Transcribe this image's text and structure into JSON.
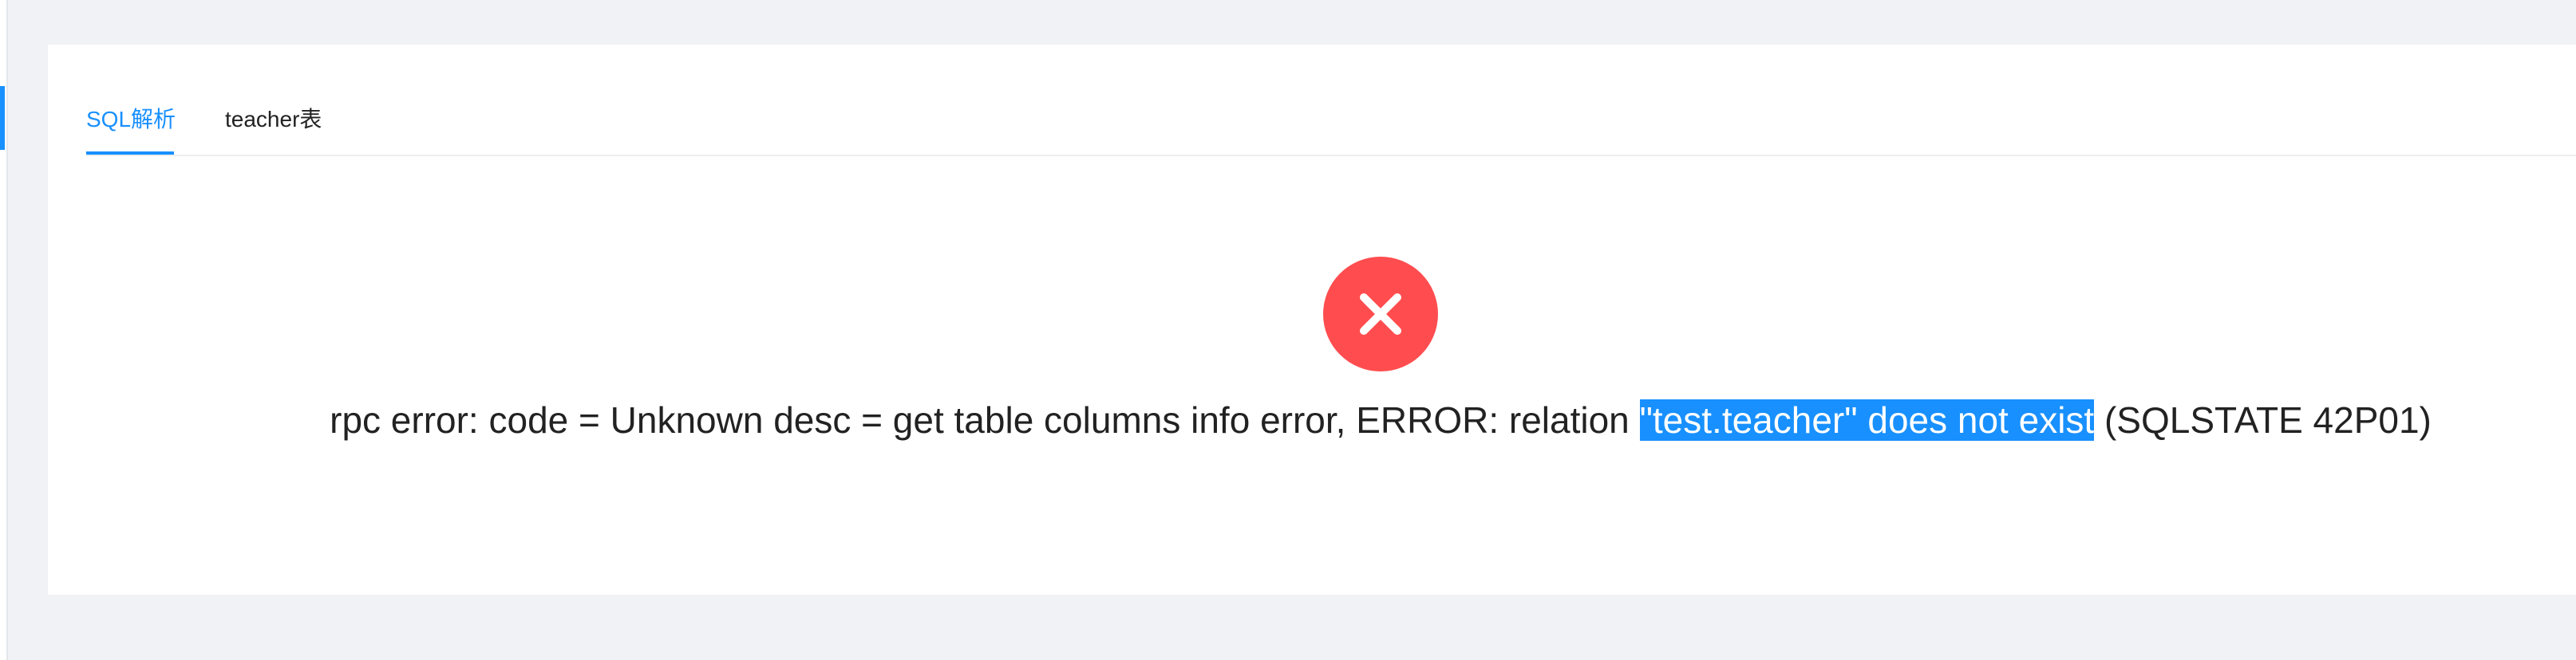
{
  "tabs": {
    "items": [
      {
        "label": "SQL解析",
        "active": true
      },
      {
        "label": "teacher表",
        "active": false
      }
    ]
  },
  "result": {
    "status": "error",
    "icon": "close-circle-icon",
    "message_before": "rpc error: code = Unknown desc = get table columns info error, ERROR: relation ",
    "message_selected": "\"test.teacher\" does not exist",
    "message_after": " (SQLSTATE 42P01)"
  },
  "colors": {
    "primary": "#1890ff",
    "error": "#ff4d4f",
    "background": "#f0f2f5"
  }
}
